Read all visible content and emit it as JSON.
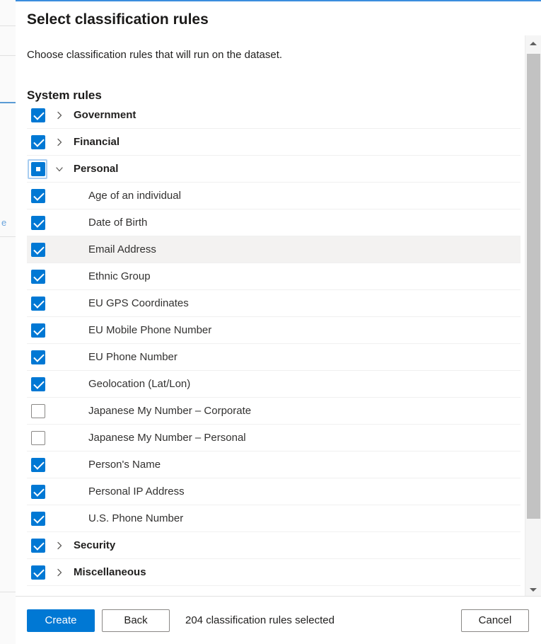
{
  "panel": {
    "title": "Select classification rules",
    "subtitle": "Choose classification rules that will run on the dataset.",
    "section_title": "System rules"
  },
  "background_page": {
    "fragment_text": "e"
  },
  "colors": {
    "accent": "#0078d4",
    "top_border": "#3a8dde",
    "hover_row": "#f3f2f1",
    "row_divider": "#f0f0f0",
    "checkbox_unchecked_border": "#8a8886",
    "scrollbar_track": "#f5f5f5",
    "scrollbar_thumb": "#c2c2c2"
  },
  "tree": {
    "rows": [
      {
        "label": "Government",
        "level": "parent",
        "state": "checked",
        "expanded": false,
        "chevron": "chevron-right-icon",
        "hovered": false,
        "focused": false
      },
      {
        "label": "Financial",
        "level": "parent",
        "state": "checked",
        "expanded": false,
        "chevron": "chevron-right-icon",
        "hovered": false,
        "focused": false
      },
      {
        "label": "Personal",
        "level": "parent",
        "state": "indeterminate",
        "expanded": true,
        "chevron": "chevron-down-icon",
        "hovered": false,
        "focused": true
      },
      {
        "label": "Age of an individual",
        "level": "child",
        "state": "checked",
        "expanded": null,
        "chevron": null,
        "hovered": false,
        "focused": false
      },
      {
        "label": "Date of Birth",
        "level": "child",
        "state": "checked",
        "expanded": null,
        "chevron": null,
        "hovered": false,
        "focused": false
      },
      {
        "label": "Email Address",
        "level": "child",
        "state": "checked",
        "expanded": null,
        "chevron": null,
        "hovered": true,
        "focused": false
      },
      {
        "label": "Ethnic Group",
        "level": "child",
        "state": "checked",
        "expanded": null,
        "chevron": null,
        "hovered": false,
        "focused": false
      },
      {
        "label": "EU GPS Coordinates",
        "level": "child",
        "state": "checked",
        "expanded": null,
        "chevron": null,
        "hovered": false,
        "focused": false
      },
      {
        "label": "EU Mobile Phone Number",
        "level": "child",
        "state": "checked",
        "expanded": null,
        "chevron": null,
        "hovered": false,
        "focused": false
      },
      {
        "label": "EU Phone Number",
        "level": "child",
        "state": "checked",
        "expanded": null,
        "chevron": null,
        "hovered": false,
        "focused": false
      },
      {
        "label": "Geolocation (Lat/Lon)",
        "level": "child",
        "state": "checked",
        "expanded": null,
        "chevron": null,
        "hovered": false,
        "focused": false
      },
      {
        "label": "Japanese My Number – Corporate",
        "level": "child",
        "state": "unchecked",
        "expanded": null,
        "chevron": null,
        "hovered": false,
        "focused": false
      },
      {
        "label": "Japanese My Number – Personal",
        "level": "child",
        "state": "unchecked",
        "expanded": null,
        "chevron": null,
        "hovered": false,
        "focused": false
      },
      {
        "label": "Person's Name",
        "level": "child",
        "state": "checked",
        "expanded": null,
        "chevron": null,
        "hovered": false,
        "focused": false
      },
      {
        "label": "Personal IP Address",
        "level": "child",
        "state": "checked",
        "expanded": null,
        "chevron": null,
        "hovered": false,
        "focused": false
      },
      {
        "label": "U.S. Phone Number",
        "level": "child",
        "state": "checked",
        "expanded": null,
        "chevron": null,
        "hovered": false,
        "focused": false
      },
      {
        "label": "Security",
        "level": "parent",
        "state": "checked",
        "expanded": false,
        "chevron": "chevron-right-icon",
        "hovered": false,
        "focused": false
      },
      {
        "label": "Miscellaneous",
        "level": "parent",
        "state": "checked",
        "expanded": false,
        "chevron": "chevron-right-icon",
        "hovered": false,
        "focused": false
      }
    ]
  },
  "scrollbar": {
    "up_arrow_icon": "scroll-up-arrow-icon",
    "down_arrow_icon": "scroll-down-arrow-icon"
  },
  "footer": {
    "create_label": "Create",
    "back_label": "Back",
    "status_text": "204 classification rules selected",
    "cancel_label": "Cancel"
  }
}
